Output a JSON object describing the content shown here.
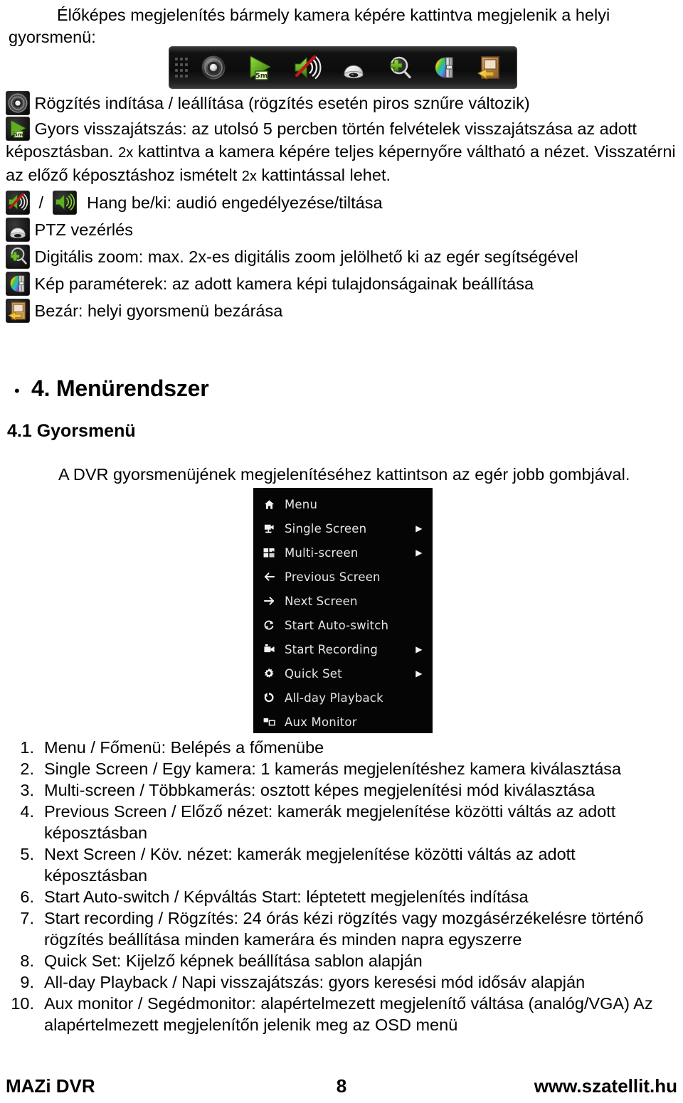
{
  "intro": {
    "paragraph": "Élőképes megjelenítés bármely kamera képére kattintva megjelenik a helyi gyorsmenü:"
  },
  "toolbar": {
    "name": "dvr-quick-toolbar",
    "background": "#0c0c0c",
    "buttons": [
      {
        "icon": "record-icon",
        "label": "Rögzítés"
      },
      {
        "icon": "quick-playback-5m-icon",
        "label": "Gyors visszajátszás",
        "badge": "5m"
      },
      {
        "icon": "audio-mute-icon",
        "label": "Hang ki"
      },
      {
        "icon": "ptz-dome-icon",
        "label": "PTZ vezérlés"
      },
      {
        "icon": "digital-zoom-icon",
        "label": "Digitális zoom"
      },
      {
        "icon": "image-settings-icon",
        "label": "Kép paraméterek"
      },
      {
        "icon": "close-door-icon",
        "label": "Bezár"
      }
    ]
  },
  "descriptions": [
    {
      "icon": "record-icon",
      "text": "Rögzítés indítása / leállítása (rögzítés esetén piros sznűre változik)"
    },
    {
      "icon": "quick-playback-5m-icon",
      "text": "Gyors visszajátszás: az utolsó 5 percben történ felvételek visszajátszása az adott képosztásban. ",
      "text2": "2x",
      "text3": " kattintva a kamera képére teljes képernyőre váltható a nézet. Visszatérni az előző képosztáshoz ismételt ",
      "text4": "2x",
      "text5": " kattintással lehet."
    },
    {
      "icon": "audio-mute-icon",
      "icon2": "audio-on-icon",
      "separator": "/",
      "text": "Hang be/ki: audió engedélyezése/tiltása"
    },
    {
      "icon": "ptz-dome-icon",
      "text": "PTZ vezérlés"
    },
    {
      "icon": "digital-zoom-icon",
      "text": "Digitális zoom: max. 2x-es digitális zoom jelölhető ki az egér segítségével"
    },
    {
      "icon": "image-settings-icon",
      "text": "Kép paraméterek: az adott kamera képi tulajdonságainak beállítása"
    },
    {
      "icon": "close-door-icon",
      "text": "Bezár: helyi gyorsmenü bezárása"
    }
  ],
  "headings": {
    "bullet": "•",
    "h1": "4. Menürendszer",
    "h2": "4.1 Gyorsmenü",
    "lead": "A DVR gyorsmenüjének megjelenítéséhez kattintson az egér jobb gombjával."
  },
  "context_menu": {
    "background": "#050505",
    "text_color": "#e4e4e4",
    "items": [
      {
        "icon": "home-icon",
        "label": "Menu",
        "submenu": false
      },
      {
        "icon": "single-camera-icon",
        "label": "Single Screen",
        "submenu": true,
        "arrow": "▶"
      },
      {
        "icon": "multi-screen-icon",
        "label": "Multi-screen",
        "submenu": true,
        "arrow": "▶"
      },
      {
        "icon": "arrow-left-icon",
        "label": "Previous Screen",
        "submenu": false
      },
      {
        "icon": "arrow-right-icon",
        "label": "Next Screen",
        "submenu": false
      },
      {
        "icon": "auto-switch-icon",
        "label": "Start Auto-switch",
        "submenu": false
      },
      {
        "icon": "camera-record-icon",
        "label": "Start Recording",
        "submenu": true,
        "arrow": "▶"
      },
      {
        "icon": "gear-icon",
        "label": "Quick Set",
        "submenu": true,
        "arrow": "▶"
      },
      {
        "icon": "playback-icon",
        "label": "All-day Playback",
        "submenu": false
      },
      {
        "icon": "aux-monitor-icon",
        "label": "Aux Monitor",
        "submenu": false
      }
    ]
  },
  "numbered_list": [
    {
      "n": "1.",
      "text": "Menu / Főmenü: Belépés a főmenübe"
    },
    {
      "n": "2.",
      "text": "Single Screen / Egy kamera: 1 kamerás megjelenítéshez kamera kiválasztása"
    },
    {
      "n": "3.",
      "text": "Multi-screen / Többkamerás: osztott képes megjelenítési mód kiválasztása"
    },
    {
      "n": "4.",
      "text": "Previous Screen / Előző nézet: kamerák megjelenítése közötti váltás az adott képosztásban"
    },
    {
      "n": "5.",
      "text": "Next Screen / Köv. nézet: kamerák megjelenítése közötti váltás az adott képosztásban"
    },
    {
      "n": "6.",
      "text": "Start Auto-switch / Képváltás Start: léptetett megjelenítés indítása"
    },
    {
      "n": "7.",
      "text": "Start recording / Rögzítés: 24 órás kézi rögzítés vagy mozgásérzékelésre történő rögzítés beállítása minden kamerára és minden napra egyszerre"
    },
    {
      "n": "8.",
      "text": "Quick Set: Kijelző képnek beállítása sablon alapján"
    },
    {
      "n": "9.",
      "text": "All-day Playback / Napi visszajátszás: gyors keresési mód idősáv alapján"
    },
    {
      "n": "10.",
      "text": "Aux monitor / Segédmonitor: alapértelmezett megjelenítő váltása (analóg/VGA) Az alapértelmezett megjelenítőn jelenik meg az OSD menü"
    }
  ],
  "footer": {
    "left": "MAZi DVR",
    "page": "8",
    "right": "www.szatellit.hu"
  }
}
